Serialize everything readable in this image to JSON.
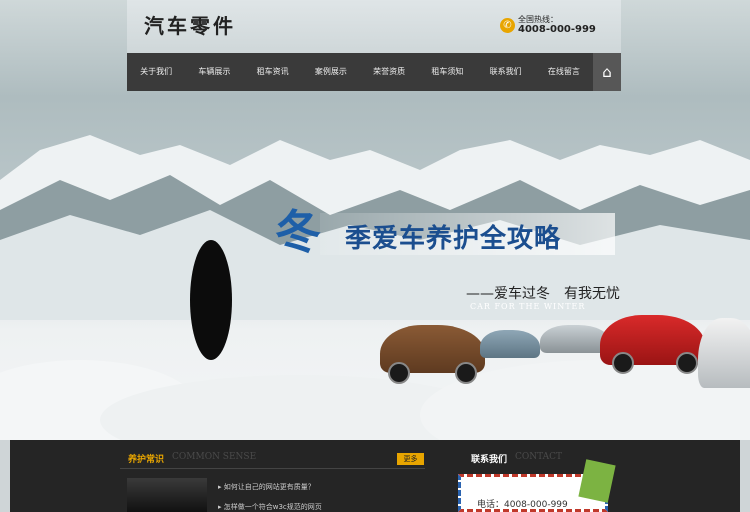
{
  "header": {
    "logo": "汽车零件",
    "hotline_label": "全国热线：",
    "hotline_number": "4008-000-999"
  },
  "nav": {
    "items": [
      "关于我们",
      "车辆展示",
      "租车资讯",
      "案例展示",
      "荣誉资质",
      "租车须知",
      "联系我们",
      "在线留言"
    ],
    "home_icon": "home-icon"
  },
  "banner": {
    "char": "冬",
    "headline": "季爱车养护全攻略",
    "subline": "——爱车过冬　有我无忧",
    "english": "CAR FOR THE WINTER"
  },
  "section_care": {
    "title": "养护常识",
    "title_en": "COMMON SENSE",
    "more": "更多",
    "items": [
      "如何让自己的网站更有质量？",
      "怎样做一个符合w3c规范的网页"
    ]
  },
  "section_contact": {
    "title": "联系我们",
    "title_en": "CONTACT",
    "phone": "电话：4008-000-999"
  },
  "colors": {
    "accent": "#e8a500",
    "nav_bg": "#3a3a3a",
    "footer_bg": "#252525",
    "headline_blue": "#1b4e8f"
  }
}
